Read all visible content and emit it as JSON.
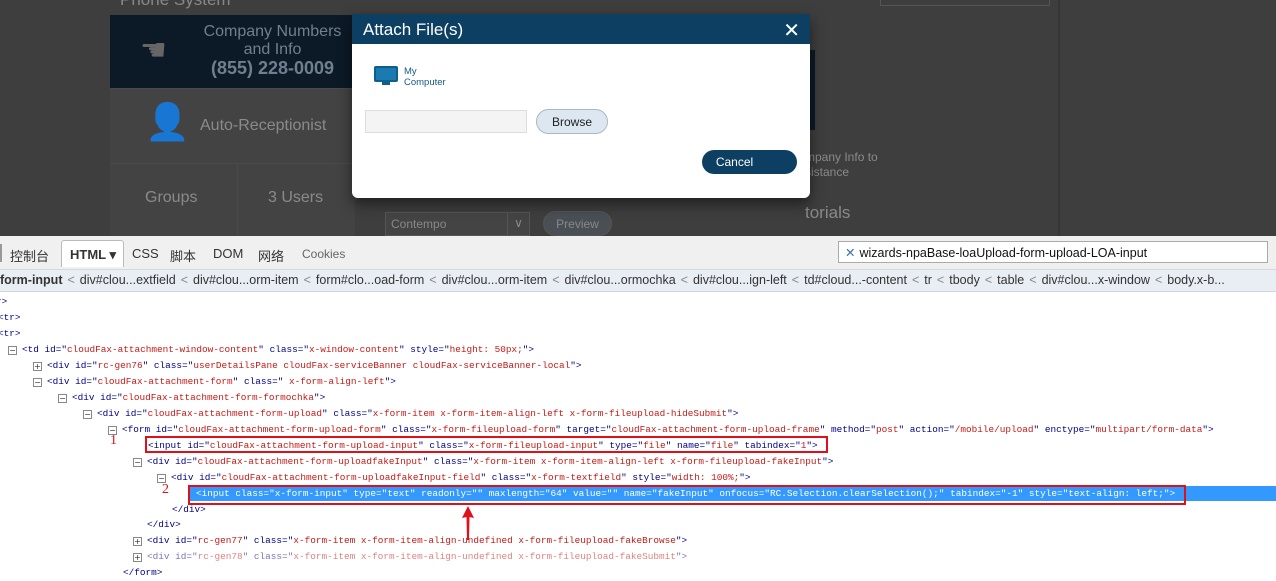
{
  "background": {
    "heading": "Phone System",
    "company_numbers": {
      "line1": "Company Numbers",
      "line2": "and Info",
      "phone": "(855) 228-0009"
    },
    "auto_receptionist": "Auto-Receptionist",
    "groups": "Groups",
    "users": "3 Users",
    "info_text_1": "mpany Info to",
    "info_text_2": "sistance",
    "tutorials": "torials",
    "theme_select": "Contempo",
    "preview_button": "Preview"
  },
  "dialog": {
    "title": "Attach File(s)",
    "source": {
      "line1": "My",
      "line2": "Computer"
    },
    "file_input_value": "",
    "browse_label": "Browse",
    "cancel_label": "Cancel"
  },
  "devtools": {
    "tabs": [
      "控制台",
      "HTML ▾",
      "CSS",
      "脚本",
      "DOM",
      "网络",
      "Cookies"
    ],
    "active_tab": "HTML",
    "search_value": "wizards-npaBase-loaUpload-form-upload-LOA-input",
    "breadcrumbs": [
      "form-input",
      "div#clou...extfield",
      "div#clou...orm-item",
      "form#clo...oad-form",
      "div#clou...orm-item",
      "div#clou...ormochka",
      "div#clou...ign-left",
      "td#cloud...-content",
      "tr",
      "tbody",
      "table",
      "div#clou...x-window",
      "body.x-b..."
    ],
    "code_lines": [
      {
        "t": "r>",
        "toggle": ""
      },
      {
        "t": "<tr>",
        "toggle": ""
      },
      {
        "t": "<tr>",
        "toggle": ""
      },
      {
        "t": "<td id=\"cloudFax-attachment-window-content\" class=\"x-window-content\" style=\"height: 50px;\">",
        "toggle": "−"
      },
      {
        "t": "<div id=\"rc-gen76\" class=\"userDetailsPane cloudFax-serviceBanner cloudFax-serviceBanner-local\">",
        "toggle": "+"
      },
      {
        "t": "<div id=\"cloudFax-attachment-form\" class=\" x-form-align-left\">",
        "toggle": "−"
      },
      {
        "t": "<div id=\"cloudFax-attachment-form-formochka\">",
        "toggle": "−"
      },
      {
        "t": "<div id=\"cloudFax-attachment-form-upload\" class=\"x-form-item x-form-item-align-left x-form-fileupload-hideSubmit\">",
        "toggle": "−"
      },
      {
        "t": "<form id=\"cloudFax-attachment-form-upload-form\" class=\"x-form-fileupload-form\" target=\"cloudFax-attachment-form-upload-frame\" method=\"post\" action=\"/mobile/upload\" enctype=\"multipart/form-data\">",
        "toggle": "−"
      },
      {
        "t": "<input id=\"cloudFax-attachment-form-upload-input\" class=\"x-form-fileupload-input\" type=\"file\" name=\"file\" tabindex=\"1\">",
        "toggle": ""
      },
      {
        "t": "<div id=\"cloudFax-attachment-form-uploadfakeInput\" class=\"x-form-item x-form-item-align-left x-form-fileupload-fakeInput\">",
        "toggle": "−"
      },
      {
        "t": "<div id=\"cloudFax-attachment-form-uploadfakeInput-field\" class=\"x-form-textfield\" style=\"width: 100%;\">",
        "toggle": "−"
      },
      {
        "t": "<input class=\"x-form-input\" type=\"text\" readonly=\"\" maxlength=\"64\" value=\"\" name=\"fakeInput\" onfocus=\"RC.Selection.clearSelection();\" tabindex=\"-1\" style=\"text-align: left;\">",
        "toggle": "",
        "selected": true
      },
      {
        "t": "</div>",
        "toggle": ""
      },
      {
        "t": "</div>",
        "toggle": ""
      },
      {
        "t": "<div id=\"rc-gen77\" class=\"x-form-item x-form-item-align-undefined x-form-fileupload-fakeBrowse\">",
        "toggle": "+"
      },
      {
        "t": "<div id=\"rc-gen78\" class=\"x-form-item x-form-item-align-undefined x-form-fileupload-fakeSubmit\">",
        "toggle": "+",
        "dim": true
      },
      {
        "t": "</form>",
        "toggle": ""
      }
    ],
    "annotations": [
      "1",
      "2"
    ],
    "selection_color": "#3399ff",
    "highlight_box_color": "#e0101a"
  }
}
